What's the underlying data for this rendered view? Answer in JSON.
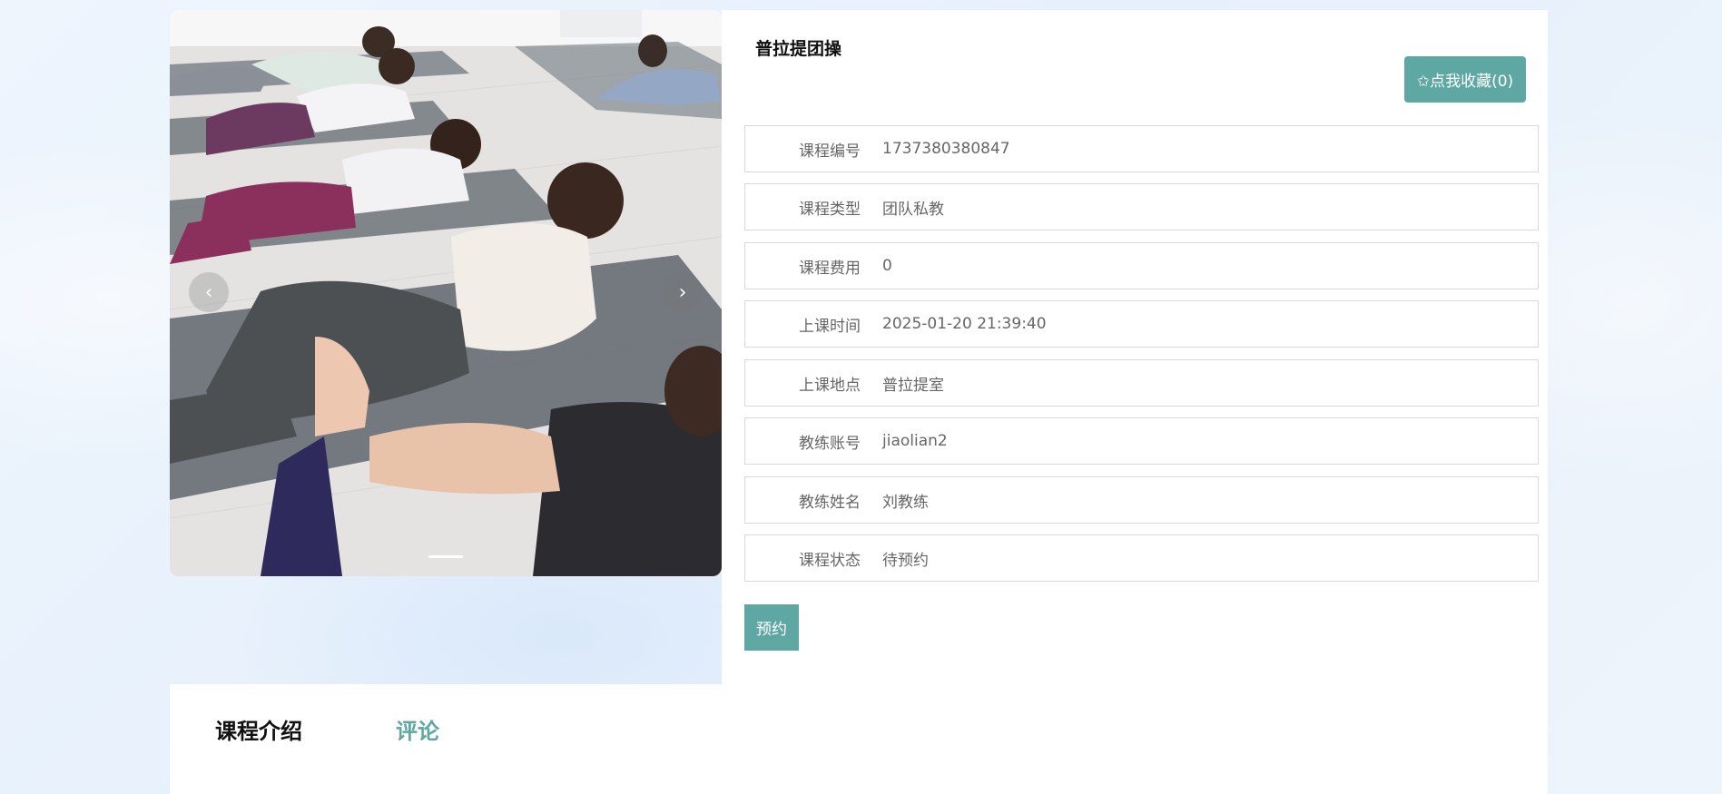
{
  "colors": {
    "accent": "#5ea7a3",
    "label_text": "#666666",
    "title_text": "#111111"
  },
  "carousel": {
    "prev_icon": "chevron-left-icon",
    "next_icon": "chevron-right-icon",
    "prev_glyph": "‹",
    "next_glyph": "›"
  },
  "course": {
    "title": "普拉提团操",
    "favorite_label": "✩点我收藏(0)",
    "fields": [
      {
        "label": "课程编号",
        "value": "1737380380847"
      },
      {
        "label": "课程类型",
        "value": "团队私教"
      },
      {
        "label": "课程费用",
        "value": "0"
      },
      {
        "label": "上课时间",
        "value": "2025-01-20 21:39:40"
      },
      {
        "label": "上课地点",
        "value": "普拉提室"
      },
      {
        "label": "教练账号",
        "value": "jiaolian2"
      },
      {
        "label": "教练姓名",
        "value": "刘教练"
      },
      {
        "label": "课程状态",
        "value": "待预约"
      }
    ],
    "book_label": "预约"
  },
  "tabs": {
    "intro": "课程介绍",
    "comments": "评论"
  }
}
